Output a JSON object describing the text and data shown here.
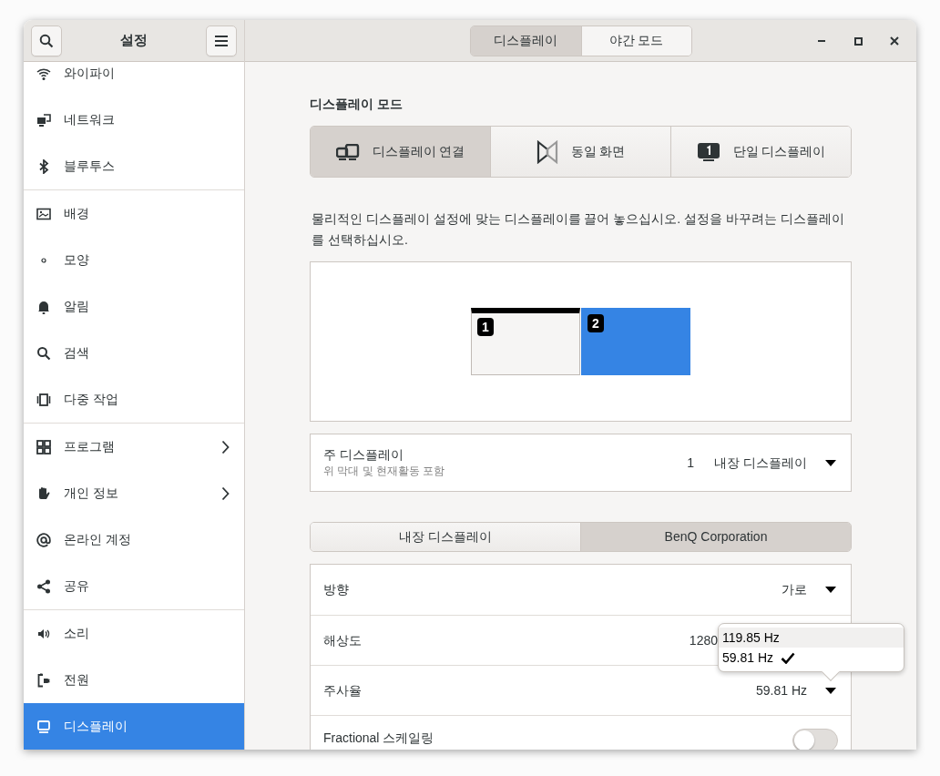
{
  "header": {
    "title": "설정"
  },
  "view_switcher": [
    {
      "label": "디스플레이",
      "selected": true
    },
    {
      "label": "야간 모드",
      "selected": false
    }
  ],
  "sidebar": {
    "groups": [
      {
        "items": [
          {
            "label": "와이파이",
            "selected": false,
            "submenu": false
          },
          {
            "label": "네트워크",
            "selected": false,
            "submenu": false
          },
          {
            "label": "블루투스",
            "selected": false,
            "submenu": false
          }
        ]
      },
      {
        "items": [
          {
            "label": "배경",
            "selected": false,
            "submenu": false
          },
          {
            "label": "모양",
            "selected": false,
            "submenu": false
          },
          {
            "label": "알림",
            "selected": false,
            "submenu": false
          },
          {
            "label": "검색",
            "selected": false,
            "submenu": false
          },
          {
            "label": "다중 작업",
            "selected": false,
            "submenu": false
          }
        ]
      },
      {
        "items": [
          {
            "label": "프로그램",
            "selected": false,
            "submenu": true
          },
          {
            "label": "개인 정보",
            "selected": false,
            "submenu": true
          },
          {
            "label": "온라인 계정",
            "selected": false,
            "submenu": false
          },
          {
            "label": "공유",
            "selected": false,
            "submenu": false
          }
        ]
      },
      {
        "items": [
          {
            "label": "소리",
            "selected": false,
            "submenu": false
          },
          {
            "label": "전원",
            "selected": false,
            "submenu": false
          },
          {
            "label": "디스플레이",
            "selected": true,
            "submenu": false
          }
        ]
      }
    ]
  },
  "display_mode": {
    "heading": "디스플레이 모드",
    "options": [
      {
        "label": "디스플레이 연결",
        "selected": true
      },
      {
        "label": "동일 화면",
        "selected": false
      },
      {
        "label": "단일 디스플레이",
        "selected": false
      }
    ]
  },
  "instructions": "물리적인 디스플레이 설정에 맞는 디스플레이를 끌어 놓으십시오. 설정을 바꾸려는 디스플레이를 선택하십시오.",
  "arrangement": {
    "monitors": [
      {
        "label": "1",
        "primary": true,
        "selected": false
      },
      {
        "label": "2",
        "primary": false,
        "selected": true
      }
    ]
  },
  "primary_display": {
    "title": "주 디스플레이",
    "subtitle": "위 막대 및 현재활동 포함",
    "number": "1",
    "value": "내장 디스플레이"
  },
  "display_tabs": [
    {
      "label": "내장 디스플레이",
      "selected": false
    },
    {
      "label": "BenQ Corporation",
      "selected": true
    }
  ],
  "settings": [
    {
      "kind": "dropdown",
      "label": "방향",
      "value": "가로"
    },
    {
      "kind": "value",
      "label": "해상도",
      "value": "1280"
    },
    {
      "kind": "dropdown",
      "label": "주사율",
      "value": "59.81 Hz",
      "options": [
        {
          "label": "119.85 Hz",
          "hovered": true,
          "selected": false
        },
        {
          "label": "59.81 Hz",
          "hovered": false,
          "selected": true
        }
      ]
    },
    {
      "kind": "switch",
      "label": "Fractional 스케일링",
      "on": false
    }
  ]
}
